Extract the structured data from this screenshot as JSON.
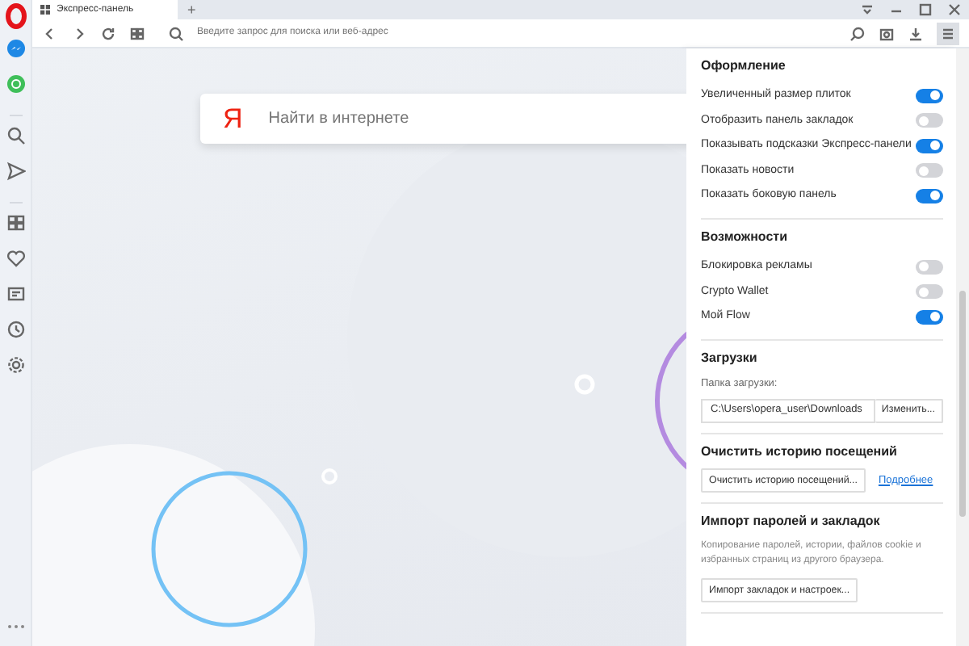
{
  "tab": {
    "title": "Экспресс-панель",
    "new_tab": "+"
  },
  "address_bar": {
    "placeholder": "Введите запрос для поиска или веб-адрес"
  },
  "search": {
    "logo": "Я",
    "placeholder": "Найти в интернете"
  },
  "settings": {
    "sections": [
      {
        "title": "Оформление",
        "items": [
          {
            "kind": "toggle",
            "label": "Увеличенный размер плиток",
            "on": true
          },
          {
            "kind": "toggle",
            "label": "Отобразить панель закладок",
            "on": false
          },
          {
            "kind": "toggle",
            "label": "Показывать подсказки Экспресс-панели",
            "on": true
          },
          {
            "kind": "toggle",
            "label": "Показать новости",
            "on": false
          },
          {
            "kind": "toggle",
            "label": "Показать боковую панель",
            "on": true
          }
        ]
      },
      {
        "title": "Возможности",
        "items": [
          {
            "kind": "toggle",
            "label": "Блокировка рекламы",
            "on": false
          },
          {
            "kind": "toggle",
            "label": "Crypto Wallet",
            "on": false
          },
          {
            "kind": "toggle",
            "label": "Мой Flow",
            "on": true
          }
        ]
      },
      {
        "title": "Загрузки",
        "items": [
          {
            "kind": "folder",
            "label": "Папка загрузки:",
            "value": "C:\\Users\\opera_user\\Downloads",
            "button": "Изменить..."
          }
        ]
      },
      {
        "title": "Очистить историю посещений",
        "items": [
          {
            "kind": "button_link",
            "button": "Очистить историю посещений...",
            "link": "Подробнее"
          }
        ]
      },
      {
        "title": "Импорт паролей и закладок",
        "items": [
          {
            "kind": "text",
            "text": "Копирование паролей, истории, файлов cookie и избранных страниц из другого браузера."
          },
          {
            "kind": "button",
            "button": "Импорт закладок и настроек..."
          }
        ]
      }
    ]
  }
}
